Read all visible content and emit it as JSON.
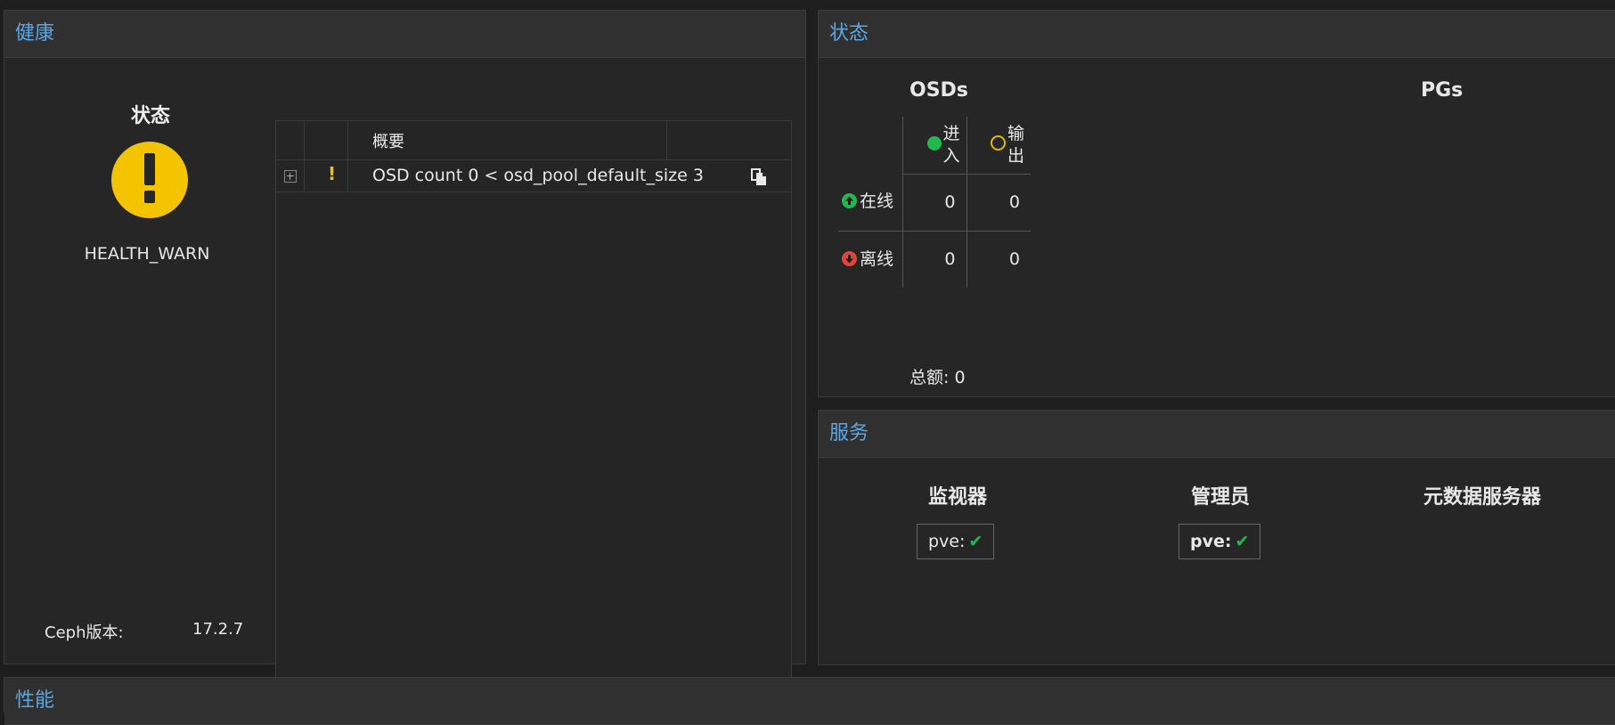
{
  "health": {
    "title": "健康",
    "status_title": "状态",
    "status_value": "HEALTH_WARN",
    "status_icon": "warning-icon",
    "ceph_version_label": "Ceph版本:",
    "ceph_version_value": "17.2.7",
    "grid": {
      "columns": [
        "",
        "",
        "概要",
        ""
      ],
      "rows": [
        {
          "severity": "!",
          "summary": "OSD count 0 < osd_pool_default_size 3"
        }
      ]
    }
  },
  "status": {
    "title": "状态",
    "osds_title": "OSDs",
    "pgs_title": "PGs",
    "col_in": "进入",
    "col_out": "输出",
    "row_up": "在线",
    "row_down": "离线",
    "values": {
      "up_in": "0",
      "up_out": "0",
      "down_in": "0",
      "down_out": "0"
    },
    "total": "总额: 0"
  },
  "services": {
    "title": "服务",
    "monitors": {
      "title": "监视器",
      "item": "pve:"
    },
    "managers": {
      "title": "管理员",
      "item": "pve:"
    },
    "mds": {
      "title": "元数据服务器"
    }
  },
  "performance": {
    "title": "性能"
  },
  "colors": {
    "accent": "#5aa7e6",
    "warn": "#f5c400",
    "ok": "#21b94e",
    "error": "#e0463c"
  }
}
